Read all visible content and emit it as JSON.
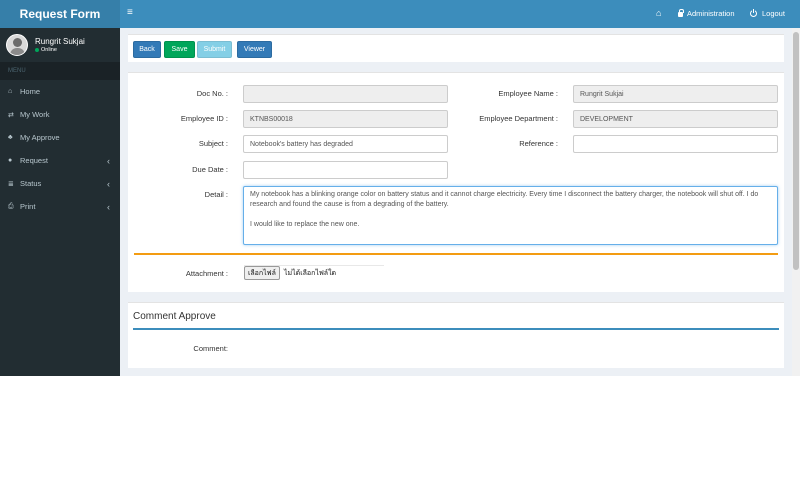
{
  "sidebar": {
    "brand": "Request Form",
    "user": {
      "name": "Rungrit Sukjai",
      "status": "Online"
    },
    "menu_header": "MENU",
    "items": [
      {
        "label": "Home",
        "icon": "home-icon",
        "glyph": "⌂",
        "chevron": ""
      },
      {
        "label": "My Work",
        "icon": "exchange-icon",
        "glyph": "⇄",
        "chevron": ""
      },
      {
        "label": "My Approve",
        "icon": "sitemap-icon",
        "glyph": "♣",
        "chevron": ""
      },
      {
        "label": "Request",
        "icon": "comment-icon",
        "glyph": "●",
        "chevron": "‹"
      },
      {
        "label": "Status",
        "icon": "list-icon",
        "glyph": "≣",
        "chevron": "‹"
      },
      {
        "label": "Print",
        "icon": "print-icon",
        "glyph": "⎙",
        "chevron": "‹"
      }
    ]
  },
  "navbar": {
    "toggle": "≡",
    "home_glyph": "⌂",
    "admin_label": "Administration",
    "logout_label": "Logout"
  },
  "toolbar": {
    "back": "Back",
    "save": "Save",
    "submit": "Submit",
    "viewer": "Viewer"
  },
  "colors": {
    "back": "#337ab7",
    "save": "#00a65a",
    "submit": "#5bc0de",
    "viewer": "#337ab7"
  },
  "form": {
    "doc_no": {
      "label": "Doc No. :",
      "value": ""
    },
    "employee_name": {
      "label": "Employee Name :",
      "value": "Rungrit Sukjai"
    },
    "employee_id": {
      "label": "Employee ID :",
      "value": "KTNBS00018"
    },
    "employee_department": {
      "label": "Employee Department :",
      "value": "DEVELOPMENT"
    },
    "subject": {
      "label": "Subject :",
      "value": "Notebook's battery has degraded"
    },
    "reference": {
      "label": "Reference :",
      "value": ""
    },
    "due_date": {
      "label": "Due Date :",
      "value": ""
    },
    "detail": {
      "label": "Detail :",
      "value": "My notebook has a blinking orange color on battery status and it cannot charge electricity. Every time I disconnect the battery charger, the notebook will shut off. I do research and found the cause is from a degrading of the battery.\n\nI would like to replace the new one."
    },
    "attachment": {
      "label": "Attachment :",
      "button": "เลือกไฟล์",
      "status": "ไม่ได้เลือกไฟล์ใด"
    }
  },
  "comment": {
    "title": "Comment Approve",
    "label": "Comment:"
  }
}
